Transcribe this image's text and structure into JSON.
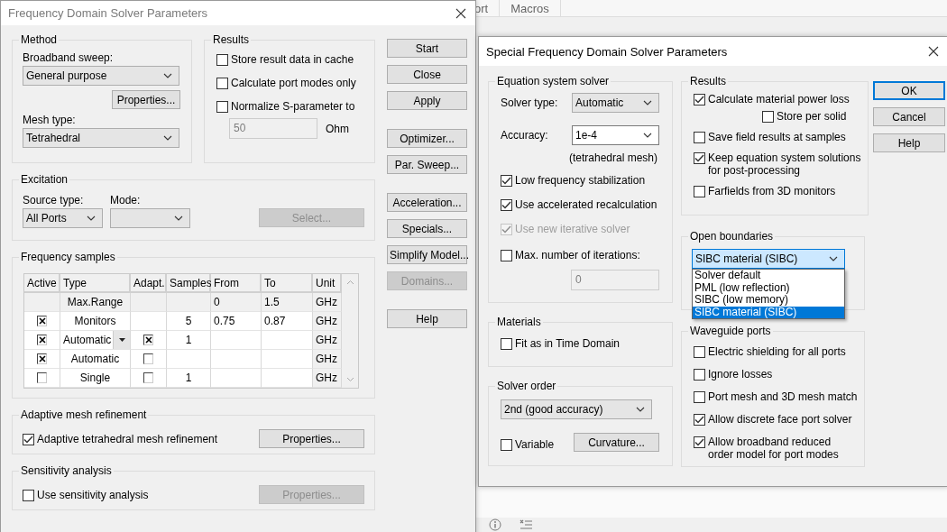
{
  "background_app": {
    "tabs": [
      "ort",
      "Macros"
    ]
  },
  "frequency_dialog": {
    "title": "Frequency Domain Solver Parameters",
    "active": false,
    "method": {
      "title": "Method",
      "broadband_label": "Broadband sweep:",
      "broadband_value": "General purpose",
      "properties_button": "Properties...",
      "mesh_label": "Mesh type:",
      "mesh_value": "Tetrahedral"
    },
    "results": {
      "title": "Results",
      "options": [
        {
          "label": "Store result data in cache",
          "checked": false
        },
        {
          "label": "Calculate port modes only",
          "checked": false
        },
        {
          "label": "Normalize S-parameter to",
          "checked": false
        }
      ],
      "impedance": {
        "value": "50",
        "disabled": true
      },
      "impedance_unit": "Ohm"
    },
    "excitation": {
      "title": "Excitation",
      "source_label": "Source type:",
      "source_value": "All Ports",
      "mode_label": "Mode:",
      "select_button": {
        "label": "Select...",
        "disabled": true
      }
    },
    "frequency_samples": {
      "title": "Frequency samples",
      "columns": [
        "Active",
        "Type",
        "Adapt.",
        "Samples",
        "From",
        "To",
        "Unit"
      ],
      "rows": [
        {
          "kind": "range",
          "type": "Max.Range",
          "dropdown": false,
          "from": "0",
          "to": "1.5",
          "unit": "GHz"
        },
        {
          "kind": "sample",
          "active": true,
          "type": "Monitors",
          "dropdown": false,
          "samples": "5",
          "from": "0.75",
          "to": "0.87",
          "unit": "GHz"
        },
        {
          "kind": "sample",
          "active": true,
          "type": "Automatic",
          "dropdown": true,
          "adapt": true,
          "samples": "1",
          "unit": "GHz"
        },
        {
          "kind": "sample",
          "active": true,
          "type": "Automatic",
          "dropdown": false,
          "adapt": false,
          "unit": "GHz"
        },
        {
          "kind": "sample",
          "active": false,
          "type": "Single",
          "dropdown": false,
          "adapt": false,
          "samples": "1",
          "unit": "GHz"
        }
      ]
    },
    "adaptive": {
      "title": "Adaptive mesh refinement",
      "option": {
        "label": "Adaptive tetrahedral mesh refinement",
        "checked": true
      },
      "properties_button": {
        "label": "Properties...",
        "disabled": false
      }
    },
    "sensitivity": {
      "title": "Sensitivity analysis",
      "option": {
        "label": "Use sensitivity analysis",
        "checked": false
      },
      "properties_button": {
        "label": "Properties...",
        "disabled": true
      }
    },
    "button_groups": [
      [
        {
          "label": "Start",
          "disabled": false
        },
        {
          "label": "Close",
          "disabled": false
        },
        {
          "label": "Apply",
          "disabled": false
        }
      ],
      [
        {
          "label": "Optimizer...",
          "disabled": false
        },
        {
          "label": "Par. Sweep...",
          "disabled": false
        }
      ],
      [
        {
          "label": "Acceleration...",
          "disabled": false
        },
        {
          "label": "Specials...",
          "disabled": false
        },
        {
          "label": "Simplify Model...",
          "disabled": false
        },
        {
          "label": "Domains...",
          "disabled": true
        }
      ],
      [
        {
          "label": "Help",
          "disabled": false
        }
      ]
    ]
  },
  "special_dialog": {
    "title": "Special Frequency Domain Solver Parameters",
    "active": true,
    "equation_solver": {
      "title": "Equation system solver",
      "solver_type_label": "Solver type:",
      "solver_type_value": "Automatic",
      "accuracy_label": "Accuracy:",
      "accuracy_value": "1e-4",
      "accuracy_note": "(tetrahedral mesh)",
      "options": [
        {
          "label": "Low frequency stabilization",
          "checked": true,
          "disabled": false
        },
        {
          "label": "Use accelerated recalculation",
          "checked": true,
          "disabled": false
        },
        {
          "label": "Use new iterative solver",
          "checked": true,
          "disabled": true
        }
      ],
      "max_iterations": {
        "label": "Max. number of iterations:",
        "checked": false,
        "value": "0",
        "value_disabled": true
      }
    },
    "materials": {
      "title": "Materials",
      "options": [
        {
          "label": "Fit as in Time Domain",
          "checked": false
        }
      ]
    },
    "solver_order": {
      "title": "Solver order",
      "value": "2nd (good accuracy)",
      "variable": {
        "label": "Variable",
        "checked": false
      },
      "curvature_button": "Curvature..."
    },
    "results": {
      "title": "Results",
      "options": [
        {
          "label": "Calculate material power loss",
          "checked": true,
          "kind": "main"
        },
        {
          "label": "Store per solid",
          "checked": false,
          "kind": "sub"
        },
        {
          "label": "Save field results at samples",
          "checked": false,
          "kind": "main"
        },
        {
          "label": "Keep equation system solutions\nfor post-processing",
          "checked": true,
          "kind": "main"
        },
        {
          "label": "Farfields from 3D monitors",
          "checked": false,
          "kind": "main"
        }
      ]
    },
    "open_boundaries": {
      "title": "Open boundaries",
      "value": "SIBC material (SIBC)",
      "expanded": true,
      "items": [
        {
          "label": "Solver default",
          "selected": false
        },
        {
          "label": "PML (low reflection)",
          "selected": false
        },
        {
          "label": "SIBC (low memory)",
          "selected": false
        },
        {
          "label": "SIBC material (SIBC)",
          "selected": true
        }
      ]
    },
    "waveguide_ports": {
      "title": "Waveguide ports",
      "options": [
        {
          "label": "Electric shielding for all ports",
          "checked": false
        },
        {
          "label": "Ignore losses",
          "checked": false
        },
        {
          "label": "Port mesh and 3D mesh match",
          "checked": false
        },
        {
          "label": "Allow discrete face port solver",
          "checked": true
        },
        {
          "label": "Allow broadband reduced\norder model for port modes",
          "checked": true
        }
      ]
    },
    "buttons": [
      {
        "label": "OK",
        "default": true
      },
      {
        "label": "Cancel",
        "default": false
      },
      {
        "label": "Help",
        "default": false
      }
    ]
  }
}
